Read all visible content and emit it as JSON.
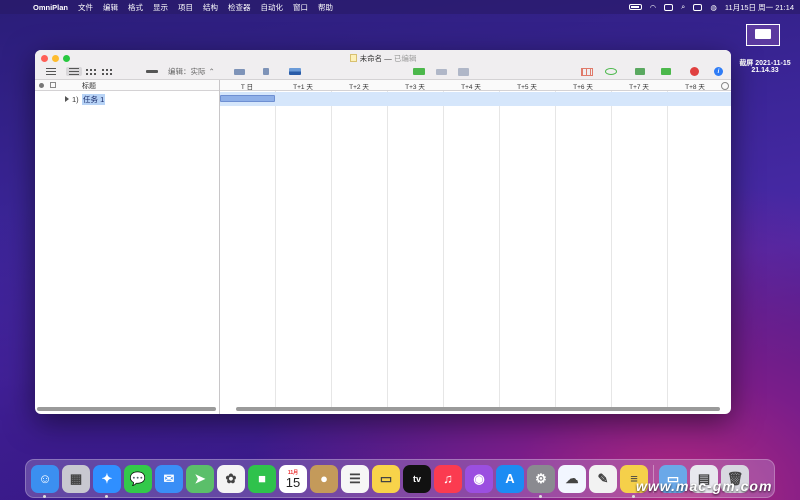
{
  "menubar": {
    "app": "OmniPlan",
    "items": [
      "文件",
      "编辑",
      "格式",
      "显示",
      "项目",
      "结构",
      "检查器",
      "自动化",
      "窗口",
      "帮助"
    ],
    "clock": "11月15日 周一  21:14"
  },
  "screenshot_thumb": {
    "line1": "截屏 2021-11-15",
    "line2": "21.14.33"
  },
  "window": {
    "title": "未命名",
    "title_sep": "—",
    "status": "已编辑",
    "toolbar": {
      "edit_mode": "编辑：实际"
    },
    "outline": {
      "column_title": "标题",
      "tasks": [
        {
          "number": "1)",
          "name": "任务 1",
          "duration_days": 1
        }
      ]
    },
    "gantt": {
      "days": [
        "T 日",
        "T+1 天",
        "T+2 天",
        "T+3 天",
        "T+4 天",
        "T+5 天",
        "T+6 天",
        "T+7 天",
        "T+8 天"
      ]
    }
  },
  "dock": {
    "items": [
      {
        "name": "finder-icon",
        "color": "#3b8ff0",
        "glyph": "☺",
        "running": true
      },
      {
        "name": "launchpad-icon",
        "color": "#c8c8d0",
        "glyph": "▦",
        "running": false
      },
      {
        "name": "safari-icon",
        "color": "#2f8fff",
        "glyph": "✦",
        "running": true
      },
      {
        "name": "messages-icon",
        "color": "#33c94a",
        "glyph": "💬",
        "running": false
      },
      {
        "name": "mail-icon",
        "color": "#3a8ef6",
        "glyph": "✉",
        "running": false
      },
      {
        "name": "maps-icon",
        "color": "#5bbf6a",
        "glyph": "➤",
        "running": false
      },
      {
        "name": "photos-icon",
        "color": "#f4f4f4",
        "glyph": "✿",
        "running": false
      },
      {
        "name": "facetime-icon",
        "color": "#2fc24c",
        "glyph": "■",
        "running": false
      },
      {
        "name": "calendar-icon",
        "color": "#ffffff",
        "glyph": "",
        "running": false
      },
      {
        "name": "contacts-icon",
        "color": "#c49a5a",
        "glyph": "●",
        "running": false
      },
      {
        "name": "reminders-icon",
        "color": "#f6f6f6",
        "glyph": "☰",
        "running": false
      },
      {
        "name": "notes-icon",
        "color": "#f8d34a",
        "glyph": "▭",
        "running": false
      },
      {
        "name": "apple-tv-icon",
        "color": "#111111",
        "glyph": "tv",
        "running": false
      },
      {
        "name": "music-icon",
        "color": "#fb3b50",
        "glyph": "♫",
        "running": false
      },
      {
        "name": "podcasts-icon",
        "color": "#9b4fe0",
        "glyph": "◉",
        "running": false
      },
      {
        "name": "app-store-icon",
        "color": "#1c8cf3",
        "glyph": "A",
        "running": false
      },
      {
        "name": "system-preferences-icon",
        "color": "#8a8a90",
        "glyph": "⚙",
        "running": true
      },
      {
        "name": "baidu-netdisk-icon",
        "color": "#f2f6ff",
        "glyph": "☁",
        "running": false
      },
      {
        "name": "textedit-icon",
        "color": "#f2f2f2",
        "glyph": "✎",
        "running": false
      },
      {
        "name": "omniplan-icon",
        "color": "#f5d04a",
        "glyph": "≡",
        "running": true
      },
      {
        "name": "downloads-folder-icon",
        "color": "#6aa8e8",
        "glyph": "▭",
        "running": false
      },
      {
        "name": "screenshot-file-icon",
        "color": "#e8e8ee",
        "glyph": "▤",
        "running": false
      },
      {
        "name": "trash-icon",
        "color": "#d8d8e0",
        "glyph": "🗑",
        "running": false
      }
    ],
    "calendar": {
      "month": "11月",
      "day": "15"
    }
  },
  "watermark": "www.mac-gm.com"
}
